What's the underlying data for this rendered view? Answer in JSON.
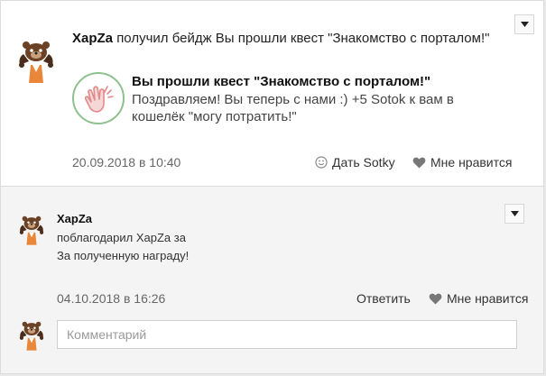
{
  "post": {
    "author": "XapZa",
    "action_text": "получил бейдж Вы прошли квест \"Знакомство с порталом!\"",
    "badge": {
      "title": "Вы прошли квест \"Знакомство с порталом!\"",
      "description": "Поздравляем! Вы теперь с нами :) +5 Sotok к вам в кошелёк \"могу потратить!\"",
      "icon": "clapping-hands-icon"
    },
    "date": "20.09.2018 в 10:40",
    "give_sotky_label": "Дать Sotky",
    "like_label": "Мне нравится"
  },
  "comment": {
    "author": "XapZa",
    "line1": "поблагодарил XapZa за",
    "line2": "За полученную награду!",
    "date": "04.10.2018 в 16:26",
    "reply_label": "Ответить",
    "like_label": "Мне нравится"
  },
  "comment_input": {
    "placeholder": "Комментарий"
  },
  "colors": {
    "badge_border": "#8fc08f",
    "avatar_orange": "#e8873a",
    "avatar_brown": "#4a2c1a"
  }
}
